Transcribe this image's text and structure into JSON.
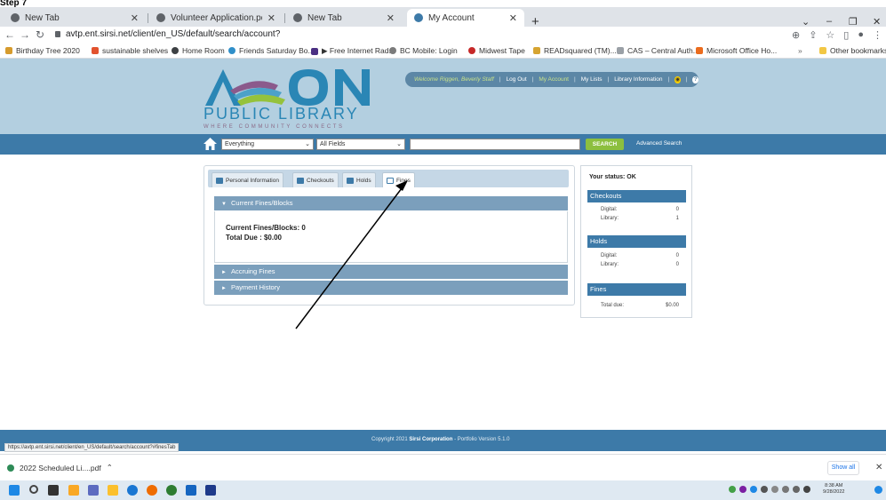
{
  "doc_title": "Step 7",
  "browser": {
    "tabs": [
      {
        "label": "New Tab",
        "active": false
      },
      {
        "label": "Volunteer Application.pdf",
        "active": false
      },
      {
        "label": "New Tab",
        "active": false
      },
      {
        "label": "My Account",
        "active": true
      }
    ],
    "url": "avtp.ent.sirsi.net/client/en_US/default/search/account?",
    "bookmarks": [
      "Birthday Tree 2020",
      "sustainable shelves",
      "Home Room",
      "Friends Saturday Bo...",
      "▶ Free Internet Rad...",
      "BC Mobile: Login",
      "Midwest Tape",
      "READsquared (TM)...",
      "CAS – Central Auth...",
      "Microsoft Office Ho..."
    ],
    "other_bookmarks": "Other bookmarks"
  },
  "site": {
    "logo_name": "PUBLIC LIBRARY",
    "logo_tagline": "WHERE COMMUNITY CONNECTS",
    "welcome": "Welcome Riggen, Beverly Staff",
    "util_links": [
      "Log Out",
      "My Account",
      "My Lists",
      "Library Information"
    ]
  },
  "search": {
    "scope": "Everything",
    "field": "All Fields",
    "query": "",
    "button": "SEARCH",
    "advanced": "Advanced Search"
  },
  "account": {
    "tabs": [
      "Personal Information",
      "Checkouts",
      "Holds",
      "Fines"
    ],
    "sections": {
      "current": "Current Fines/Blocks",
      "accruing": "Accruing Fines",
      "payment": "Payment History"
    },
    "fines_line": "Current Fines/Blocks: 0",
    "total_line": "Total Due : $0.00"
  },
  "status": {
    "title": "Your status: OK",
    "checkouts_head": "Checkouts",
    "checkouts": [
      {
        "label": "Digital:",
        "value": "0"
      },
      {
        "label": "Library:",
        "value": "1"
      }
    ],
    "holds_head": "Holds",
    "holds": [
      {
        "label": "Digital:",
        "value": "0"
      },
      {
        "label": "Library:",
        "value": "0"
      }
    ],
    "fines_head": "Fines",
    "fines": [
      {
        "label": "Total due:",
        "value": "$0.00"
      }
    ]
  },
  "footer": {
    "copyright_prefix": "Copyright 2021",
    "company": "Sirsi Corporation",
    "version": "- Portfolio Version 5.1.0"
  },
  "status_url": "https://avtp.ent.sirsi.net/client/en_US/default/search/account?#finesTab",
  "download": {
    "file": "2022 Scheduled Li....pdf",
    "show_all": "Show all"
  },
  "clock": {
    "time": "8:38 AM",
    "date": "9/28/2022"
  }
}
